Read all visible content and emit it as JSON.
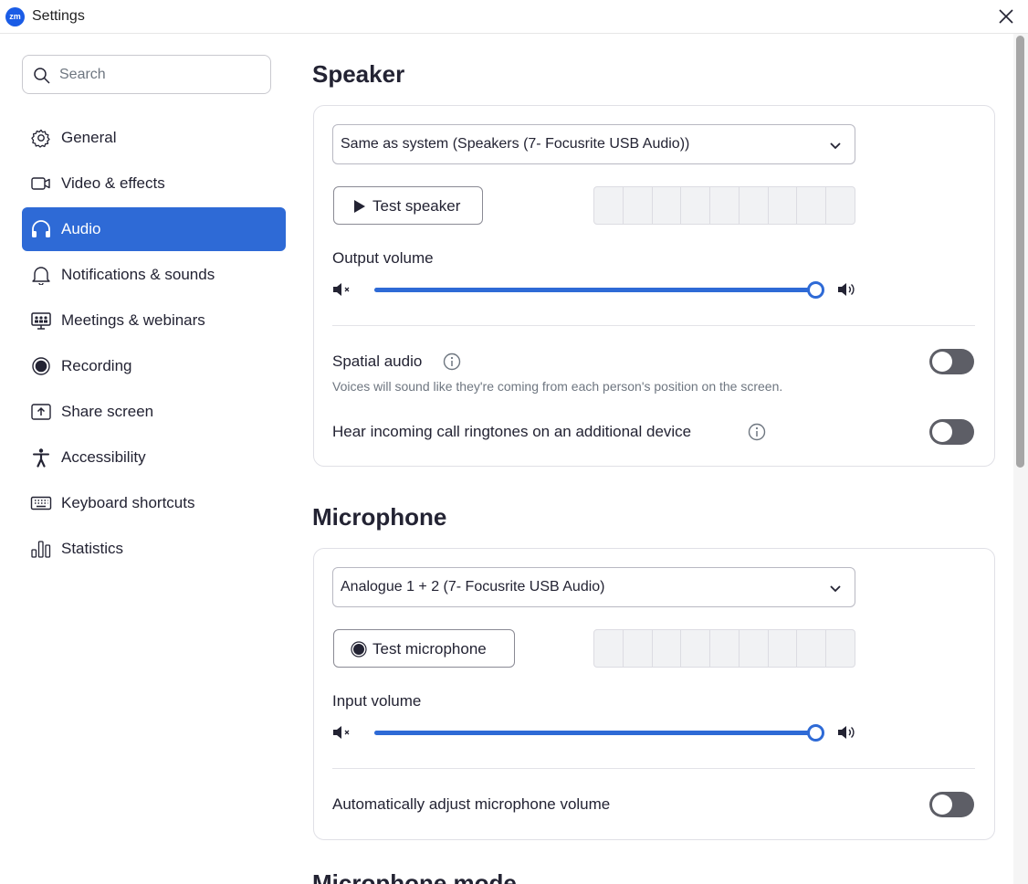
{
  "window": {
    "logo_text": "zm",
    "title": "Settings"
  },
  "search": {
    "placeholder": "Search"
  },
  "sidebar": {
    "items": [
      {
        "label": "General",
        "icon": "gear-icon"
      },
      {
        "label": "Video & effects",
        "icon": "video-camera-icon"
      },
      {
        "label": "Audio",
        "icon": "headphones-icon",
        "active": true
      },
      {
        "label": "Notifications & sounds",
        "icon": "bell-icon"
      },
      {
        "label": "Meetings & webinars",
        "icon": "meeting-screen-icon"
      },
      {
        "label": "Recording",
        "icon": "record-icon"
      },
      {
        "label": "Share screen",
        "icon": "share-screen-icon"
      },
      {
        "label": "Accessibility",
        "icon": "accessibility-icon"
      },
      {
        "label": "Keyboard shortcuts",
        "icon": "keyboard-icon"
      },
      {
        "label": "Statistics",
        "icon": "bar-chart-icon"
      }
    ]
  },
  "speaker": {
    "title": "Speaker",
    "device": "Same as system (Speakers (7- Focusrite USB Audio))",
    "test_label": "Test speaker",
    "volume_label": "Output volume",
    "volume_level": 1.0,
    "spatial_label": "Spatial audio",
    "spatial_desc": "Voices will sound like they're coming from each person's position on the screen.",
    "spatial_enabled": false,
    "ringtone_label": "Hear incoming call ringtones on an additional device",
    "ringtone_enabled": false
  },
  "microphone": {
    "title": "Microphone",
    "device": "Analogue 1 + 2 (7- Focusrite USB Audio)",
    "test_label": "Test microphone",
    "volume_label": "Input volume",
    "volume_level": 1.0,
    "auto_adjust_label": "Automatically adjust microphone volume",
    "auto_adjust_enabled": false
  },
  "next_section_title": "Microphone mode",
  "colors": {
    "accent": "#2e6ad6",
    "toggle_off": "#5d5e66",
    "text": "#232333",
    "muted_text": "#6e7680"
  }
}
